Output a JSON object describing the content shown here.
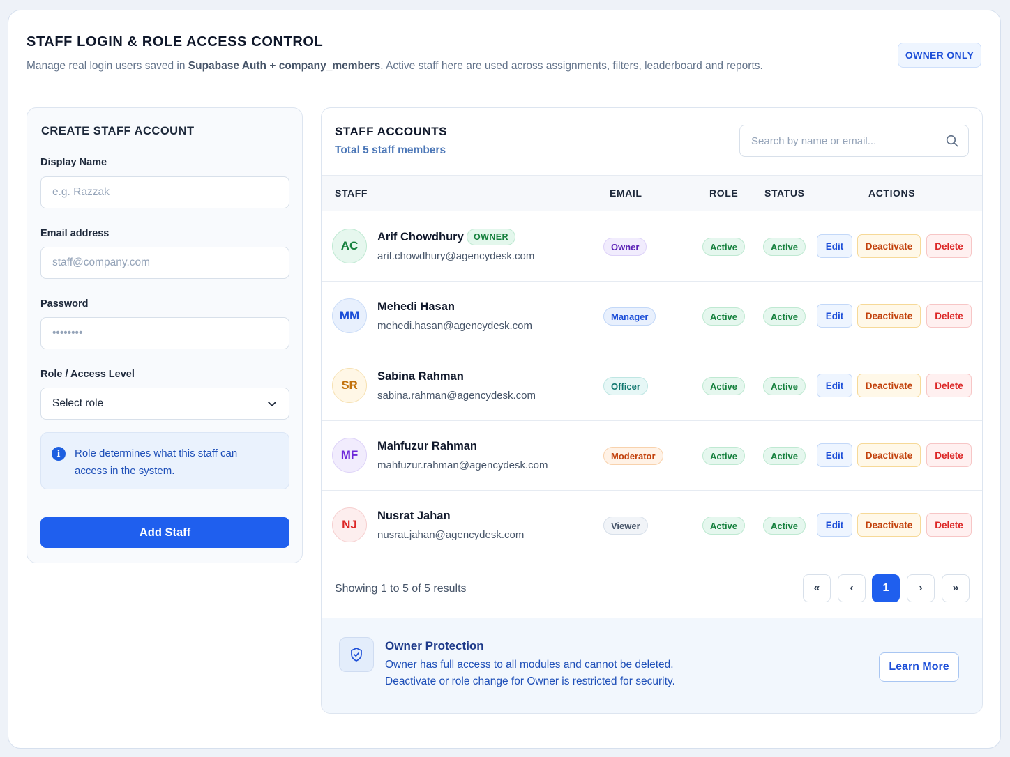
{
  "header": {
    "title": "STAFF LOGIN & ROLE ACCESS CONTROL",
    "subtitle_prefix": "Manage real login users saved in ",
    "subtitle_bold": "Supabase Auth + company_members",
    "subtitle_suffix": ". Active staff here are used across assignments, filters, leaderboard and reports.",
    "badge": "OWNER ONLY"
  },
  "create_form": {
    "title": "CREATE STAFF ACCOUNT",
    "display_name_label": "Display Name",
    "display_name_placeholder": "e.g. Razzak",
    "email_label": "Email address",
    "email_placeholder": "staff@company.com",
    "password_label": "Password",
    "password_placeholder": "••••••••",
    "role_label": "Role / Access Level",
    "role_selected": "Select role",
    "info_text": "Role determines what this staff can access in the system.",
    "submit_label": "Add Staff"
  },
  "staff_list": {
    "title": "STAFF ACCOUNTS",
    "subtitle": "Total 5 staff members",
    "search_placeholder": "Search by name or email...",
    "columns": [
      "STAFF",
      "EMAIL",
      "ROLE",
      "STATUS",
      "ACTIONS"
    ],
    "owner_tag": "OWNER",
    "action_labels": {
      "edit": "Edit",
      "deactivate": "Deactivate",
      "delete": "Delete"
    },
    "rows": [
      {
        "initials": "AC",
        "name": "Arif Chowdhury",
        "email": "arif.chowdhury@agencydesk.com",
        "role": "Owner",
        "role_status": "Active",
        "status": "Active",
        "is_owner": true
      },
      {
        "initials": "MM",
        "name": "Mehedi Hasan",
        "email": "mehedi.hasan@agencydesk.com",
        "role": "Manager",
        "role_status": "Active",
        "status": "Active",
        "is_owner": false
      },
      {
        "initials": "SR",
        "name": "Sabina Rahman",
        "email": "sabina.rahman@agencydesk.com",
        "role": "Officer",
        "role_status": "Active",
        "status": "Active",
        "is_owner": false
      },
      {
        "initials": "MF",
        "name": "Mahfuzur Rahman",
        "email": "mahfuzur.rahman@agencydesk.com",
        "role": "Moderator",
        "role_status": "Active",
        "status": "Active",
        "is_owner": false
      },
      {
        "initials": "NJ",
        "name": "Nusrat Jahan",
        "email": "nusrat.jahan@agencydesk.com",
        "role": "Viewer",
        "role_status": "Active",
        "status": "Active",
        "is_owner": false
      }
    ],
    "showing_text": "Showing 1 to 5 of 5 results",
    "pagination": {
      "first": "«",
      "prev": "‹",
      "current": "1",
      "next": "›",
      "last": "»"
    }
  },
  "protection": {
    "title": "Owner Protection",
    "line1": "Owner has full access to all modules and cannot be deleted.",
    "line2": "Deactivate or role change for Owner is restricted for security.",
    "learn_more": "Learn More"
  },
  "colors": {
    "primary": "#1f5fee",
    "avatar": {
      "AC": {
        "bg": "#e6f7ee",
        "border": "#bfe9d2",
        "fg": "#15803d"
      },
      "MM": {
        "bg": "#e8f0fd",
        "border": "#c9dbf7",
        "fg": "#1d4fd8"
      },
      "SR": {
        "bg": "#fff7e6",
        "border": "#f6e0b0",
        "fg": "#c2710c"
      },
      "MF": {
        "bg": "#f1ecfd",
        "border": "#ddd2f8",
        "fg": "#6d28d9"
      },
      "NJ": {
        "bg": "#fdeeee",
        "border": "#f6cfcf",
        "fg": "#dc2626"
      }
    },
    "role": {
      "Owner": {
        "bg": "#f1ecfd",
        "border": "#ddd2f8",
        "fg": "#5b21b6"
      },
      "Manager": {
        "bg": "#e8f0fd",
        "border": "#c3d8f8",
        "fg": "#1d4fd8"
      },
      "Officer": {
        "bg": "#e6f7f6",
        "border": "#bfe6e3",
        "fg": "#0f766e"
      },
      "Moderator": {
        "bg": "#fff2e6",
        "border": "#f8d2ad",
        "fg": "#c2410c"
      },
      "Viewer": {
        "bg": "#f1f4f8",
        "border": "#d8e0ea",
        "fg": "#475569"
      }
    }
  }
}
